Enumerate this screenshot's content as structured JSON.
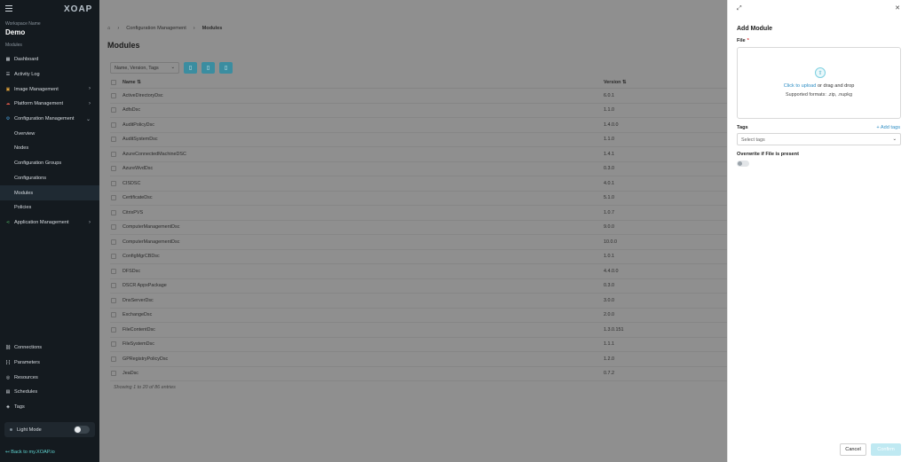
{
  "sidebar": {
    "logo": "XOAP",
    "workspace_label": "Workspace Name",
    "workspace_name": "Demo",
    "section_label": "Modules",
    "items": [
      {
        "label": "Dashboard",
        "icon": "grid-icon"
      },
      {
        "label": "Activity Log",
        "icon": "list-icon"
      },
      {
        "label": "Image Management",
        "icon": "image-icon",
        "expandable": true
      },
      {
        "label": "Platform Management",
        "icon": "cloud-icon",
        "expandable": true
      },
      {
        "label": "Configuration Management",
        "icon": "gear-icon",
        "expanded": true
      }
    ],
    "sub_items": [
      "Overview",
      "Nodes",
      "Configuration Groups",
      "Configurations",
      "Modules",
      "Policies"
    ],
    "active_sub_item": "Modules",
    "app_item": "Application Management",
    "bottom_items": [
      "Connections",
      "Parameters",
      "Resources",
      "Schedules",
      "Tags"
    ],
    "light_mode_label": "Light Mode",
    "back_link": "Back to my.XOAP.io"
  },
  "breadcrumb": [
    "Configuration Management",
    "Modules"
  ],
  "page_title": "Modules",
  "toolbar": {
    "search_placeholder": "Name, Version, Tags"
  },
  "table": {
    "columns": [
      "Name",
      "Version"
    ],
    "rows": [
      [
        "ActiveDirectoryDsc",
        "6.0.1"
      ],
      [
        "AdfsDsc",
        "1.1.0"
      ],
      [
        "AuditPolicyDsc",
        "1.4.0.0"
      ],
      [
        "AuditSystemDsc",
        "1.1.0"
      ],
      [
        "AzureConnectedMachineDSC",
        "1.4.1"
      ],
      [
        "AzureWvdDsc",
        "0.3.0"
      ],
      [
        "CISDSC",
        "4.0.1"
      ],
      [
        "CertificateDsc",
        "5.1.0"
      ],
      [
        "CitrixPVS",
        "1.0.7"
      ],
      [
        "ComputerManagementDsc",
        "9.0.0"
      ],
      [
        "ComputerManagementDsc",
        "10.0.0"
      ],
      [
        "ConfigMgrCBDsc",
        "1.0.1"
      ],
      [
        "DFSDsc",
        "4.4.0.0"
      ],
      [
        "DSCR AppxPackage",
        "0.3.0"
      ],
      [
        "DnsServerDsc",
        "3.0.0"
      ],
      [
        "ExchangeDsc",
        "2.0.0"
      ],
      [
        "FileContentDsc",
        "1.3.0.151"
      ],
      [
        "FileSystemDsc",
        "1.1.1"
      ],
      [
        "GPRegistryPolicyDsc",
        "1.2.0"
      ],
      [
        "JeaDsc",
        "0.7.2"
      ]
    ],
    "footer": "Showing 1 to 20 of 86 entries"
  },
  "drawer": {
    "title": "Add Module",
    "file_label": "File",
    "required_mark": "*",
    "upload_link": "Click to upload",
    "upload_rest": " or drag and drop",
    "formats": "Supported formats: .zip, .nupkg",
    "tags_label": "Tags",
    "add_tags": "Add tags",
    "tags_placeholder": "Select tags",
    "overwrite_label": "Overwrite if File is present",
    "cancel": "Cancel",
    "confirm": "Confirm"
  }
}
